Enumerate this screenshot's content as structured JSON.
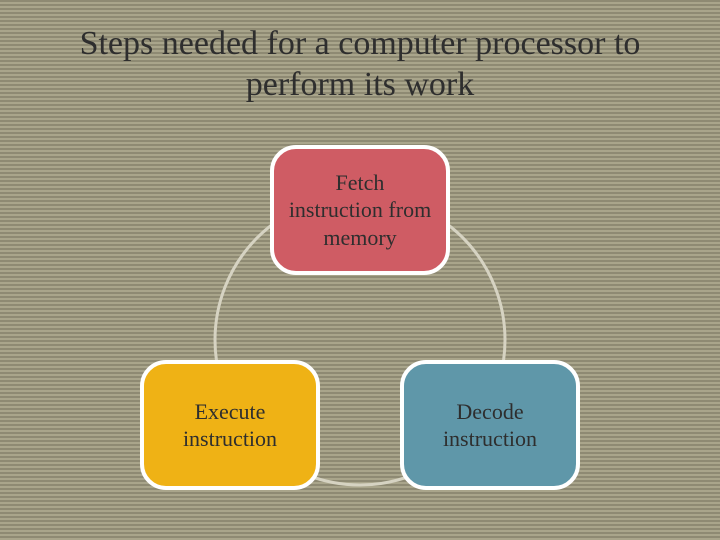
{
  "title": "Steps needed for a computer processor to perform its work",
  "nodes": {
    "fetch": {
      "label": "Fetch instruction from memory",
      "color": "#cf5c64"
    },
    "decode": {
      "label": "Decode instruction",
      "color": "#5f97a9"
    },
    "execute": {
      "label": "Execute instruction",
      "color": "#efb215"
    }
  },
  "cycle_order": [
    "fetch",
    "decode",
    "execute"
  ],
  "colors": {
    "circle_stroke": "#d6d3c2",
    "node_border": "#ffffff",
    "text": "#2e2e2e"
  }
}
